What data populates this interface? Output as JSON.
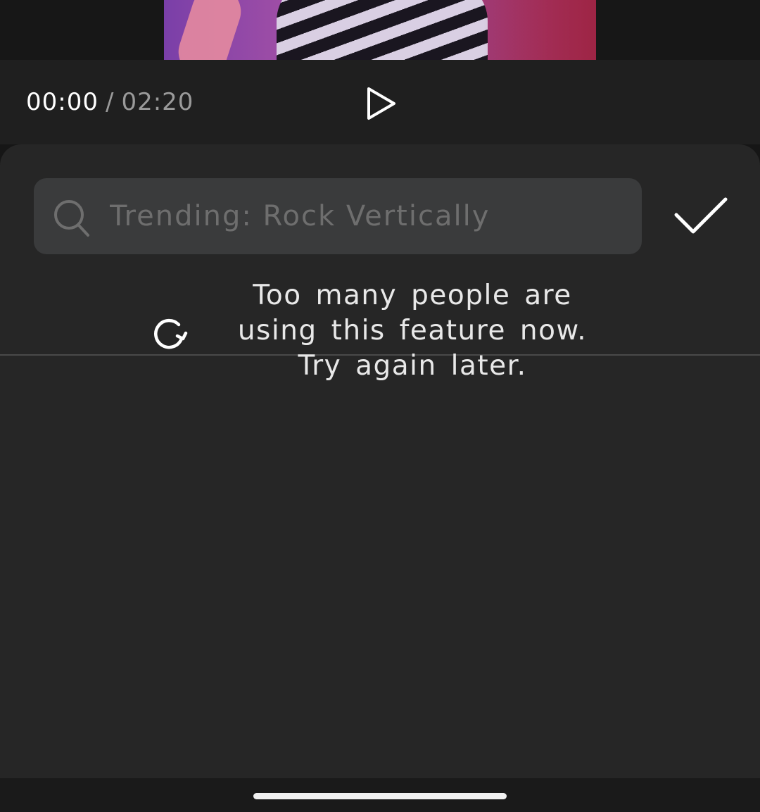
{
  "player": {
    "current_time": "00:00",
    "separator": "/",
    "duration": "02:20"
  },
  "search": {
    "placeholder": "Trending: Rock Vertically",
    "value": ""
  },
  "status": {
    "message": "Too many people are using this feature now. Try again later."
  },
  "icons": {
    "play": "play-icon",
    "search": "search-icon",
    "confirm": "checkmark-icon",
    "refresh": "refresh-icon"
  },
  "colors": {
    "sheet_background": "#262626",
    "search_field": "#3a3b3c",
    "text_primary": "#e8e8e8",
    "text_muted": "#9a9a9a"
  }
}
